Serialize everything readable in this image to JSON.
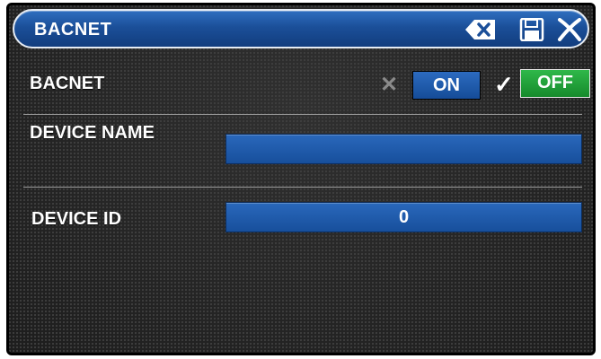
{
  "header": {
    "title": "BACNET",
    "icons": [
      "clear-icon",
      "save-icon",
      "close-icon"
    ]
  },
  "rows": {
    "bacnet": {
      "label": "BACNET",
      "on_label": "ON",
      "off_label": "OFF",
      "selected": "OFF"
    },
    "device_name": {
      "label": "DEVICE NAME",
      "value": ""
    },
    "device_id": {
      "label": "DEVICE ID",
      "value": "0"
    }
  },
  "colors": {
    "accent_blue": "#1b4f99",
    "off_green": "#1fa03a",
    "background": "#262626"
  }
}
